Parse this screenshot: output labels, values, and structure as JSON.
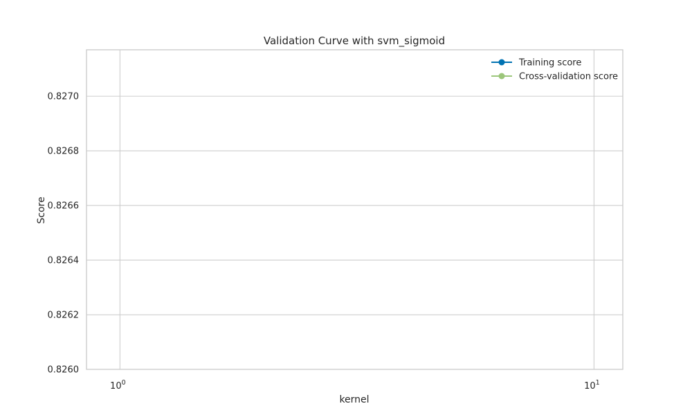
{
  "chart_data": {
    "type": "line",
    "title": "Validation Curve with svm_sigmoid",
    "xlabel": "kernel",
    "ylabel": "Score",
    "x_scale": "log",
    "xlim": [
      0.85,
      11.5
    ],
    "ylim": [
      0.826,
      0.82717
    ],
    "x_ticks": [
      {
        "value": 1,
        "base": "10",
        "exp": "0"
      },
      {
        "value": 10,
        "base": "10",
        "exp": "1"
      }
    ],
    "y_ticks": [
      0.826,
      0.8262,
      0.8264,
      0.8266,
      0.8268,
      0.827
    ],
    "y_tick_labels": [
      "0.8260",
      "0.8262",
      "0.8264",
      "0.8266",
      "0.8268",
      "0.8270"
    ],
    "grid": true,
    "legend_position": "top-right",
    "series": [
      {
        "name": "Training score",
        "color": "#0072b2",
        "x": [],
        "values": []
      },
      {
        "name": "Cross-validation score",
        "color": "#9cc67a",
        "x": [],
        "values": []
      }
    ]
  }
}
